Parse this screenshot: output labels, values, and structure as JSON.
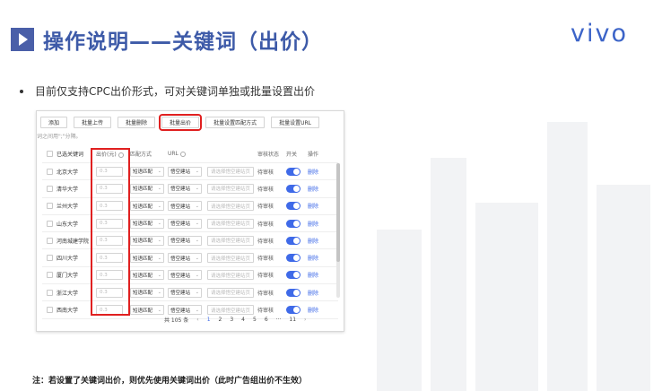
{
  "slide": {
    "title": "操作说明——关键词（出价）",
    "logo": "vivo",
    "bullet": "目前仅支持CPC出价形式，可对关键词单独或批量设置出价",
    "note": "注：若设置了关键词出价，则优先使用关键词出价（此时广告组出价不生效）"
  },
  "toolbar": {
    "buttons": [
      "添加",
      "批量上传",
      "批量删除",
      "批量出价",
      "批量设置匹配方式",
      "批量设置URL"
    ]
  },
  "hint": "词之间用\";\"分隔。",
  "table": {
    "headers": {
      "keyword": "已选关键词",
      "bid": "出价(元)",
      "match": "匹配方式",
      "url": "URL",
      "status": "审核状态",
      "switch": "开关",
      "op": "操作"
    },
    "rows": [
      {
        "keyword": "北京大学",
        "bid": "0.3",
        "match": "短语匹配",
        "url": "悟空建站",
        "url_placeholder": "请选择悟空建站页",
        "status": "待审核",
        "op": "删除"
      },
      {
        "keyword": "清华大学",
        "bid": "0.3",
        "match": "短语匹配",
        "url": "悟空建站",
        "url_placeholder": "请选择悟空建站页",
        "status": "待审核",
        "op": "删除"
      },
      {
        "keyword": "兰州大学",
        "bid": "0.3",
        "match": "短语匹配",
        "url": "悟空建站",
        "url_placeholder": "请选择悟空建站页",
        "status": "待审核",
        "op": "删除"
      },
      {
        "keyword": "山东大学",
        "bid": "0.3",
        "match": "短语匹配",
        "url": "悟空建站",
        "url_placeholder": "请选择悟空建站页",
        "status": "待审核",
        "op": "删除"
      },
      {
        "keyword": "河南城建学院",
        "bid": "0.3",
        "match": "短语匹配",
        "url": "悟空建站",
        "url_placeholder": "请选择悟空建站页",
        "status": "待审核",
        "op": "删除"
      },
      {
        "keyword": "四川大学",
        "bid": "0.3",
        "match": "短语匹配",
        "url": "悟空建站",
        "url_placeholder": "请选择悟空建站页",
        "status": "待审核",
        "op": "删除"
      },
      {
        "keyword": "厦门大学",
        "bid": "0.3",
        "match": "短语匹配",
        "url": "悟空建站",
        "url_placeholder": "请选择悟空建站页",
        "status": "待审核",
        "op": "删除"
      },
      {
        "keyword": "浙江大学",
        "bid": "0.3",
        "match": "短语匹配",
        "url": "悟空建站",
        "url_placeholder": "请选择悟空建站页",
        "status": "待审核",
        "op": "删除"
      },
      {
        "keyword": "西南大学",
        "bid": "0.3",
        "match": "短语匹配",
        "url": "悟空建站",
        "url_placeholder": "请选择悟空建站页",
        "status": "待审核",
        "op": "删除"
      }
    ]
  },
  "pager": {
    "total": "共 105 条",
    "pages": [
      "1",
      "2",
      "3",
      "4",
      "5",
      "6",
      "···",
      "11"
    ],
    "current": "1",
    "prev_icon": "chevron-left-icon",
    "next_icon": "chevron-right-icon"
  },
  "colors": {
    "title": "#3d5aa8",
    "accent": "#3f6ae8",
    "highlight": "#e02020"
  }
}
